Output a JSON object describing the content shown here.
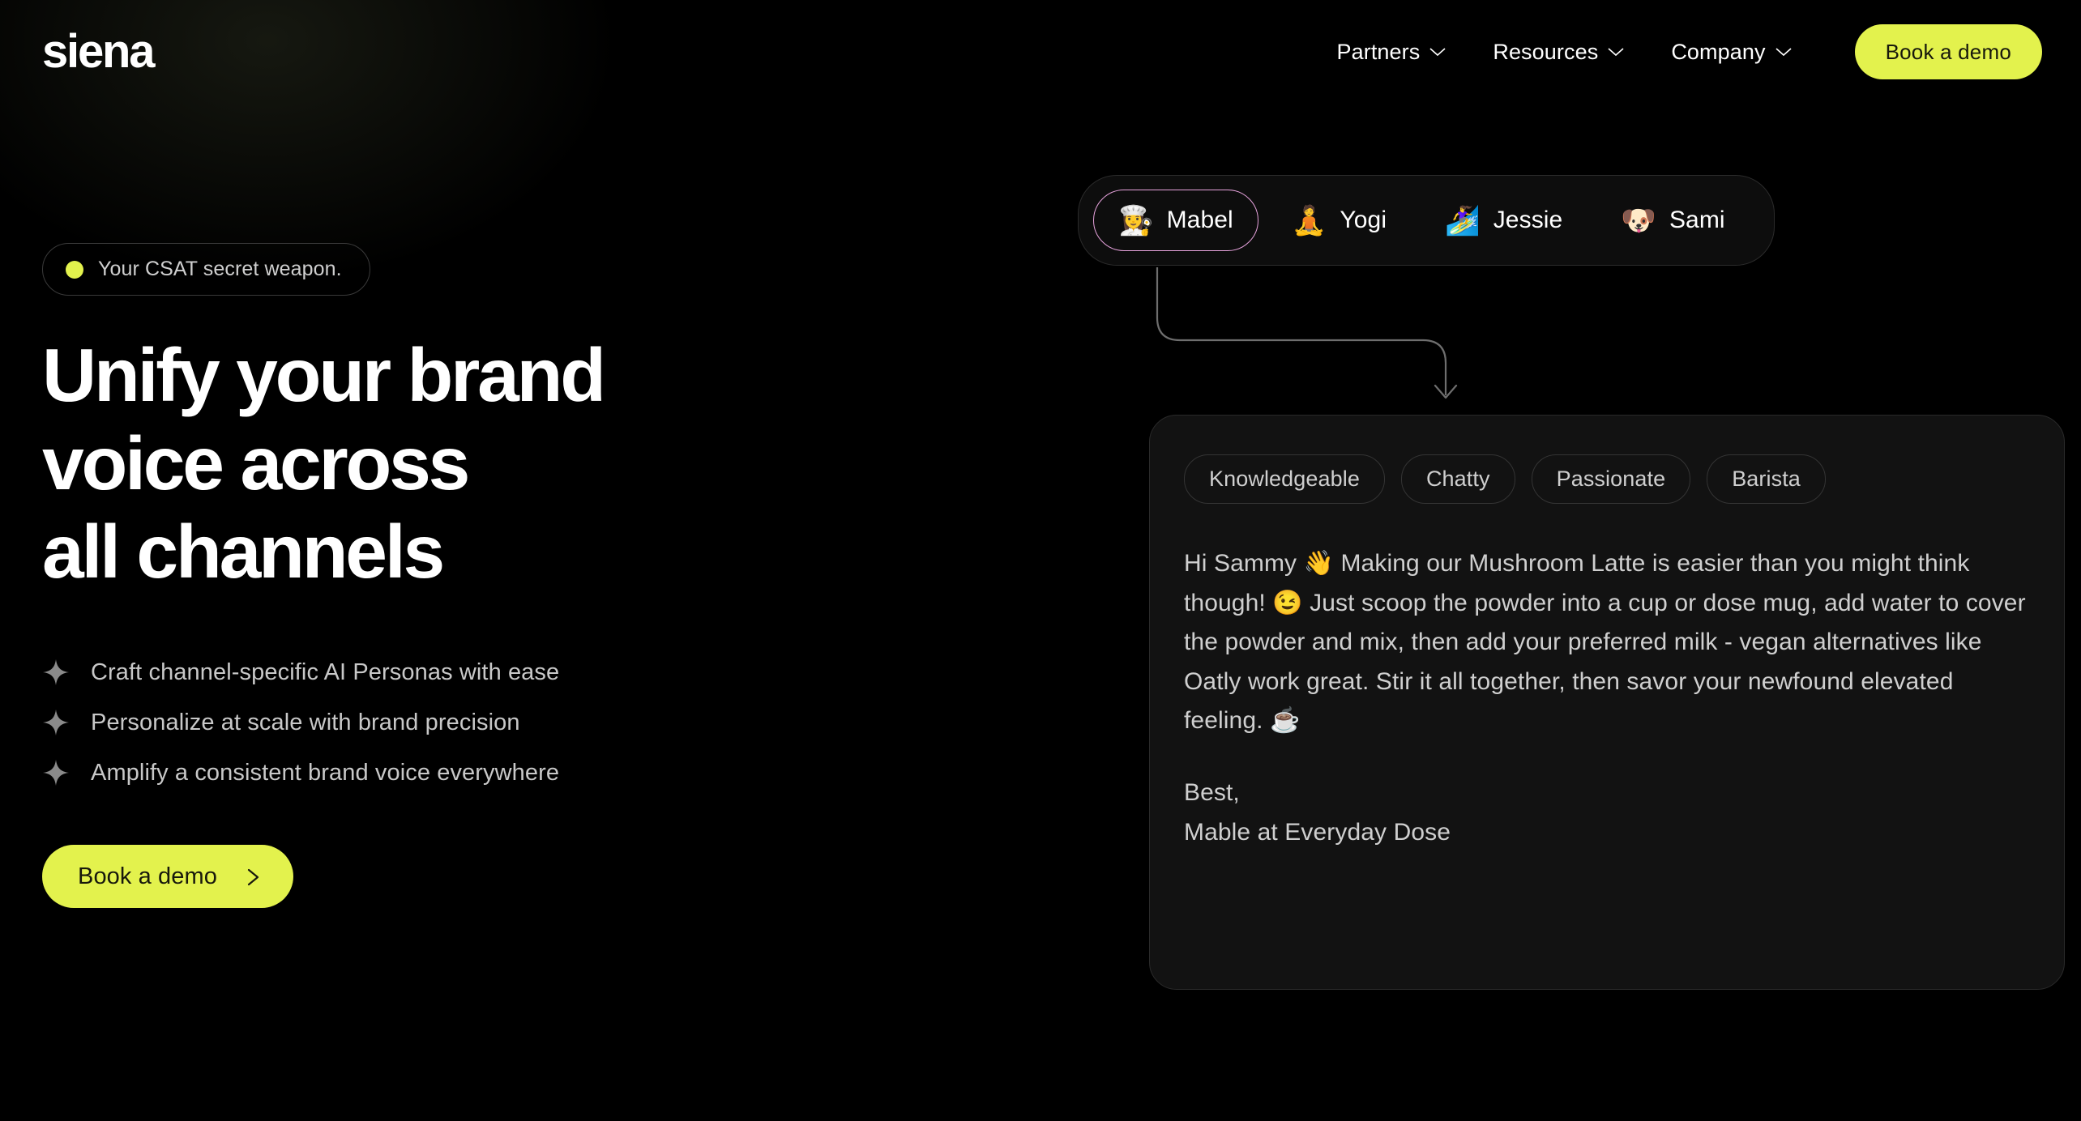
{
  "theme": {
    "background": "#000000",
    "accent": "#e3f24d",
    "accent_text": "#17180c",
    "card_bg": "#121212",
    "card_border": "#2a2a2a",
    "active_persona_border": "#e7a3dd",
    "body_text": "#cfcfcf"
  },
  "header": {
    "logo": "siena",
    "nav": [
      {
        "label": "Partners",
        "icon": "chevron-down-icon"
      },
      {
        "label": "Resources",
        "icon": "chevron-down-icon"
      },
      {
        "label": "Company",
        "icon": "chevron-down-icon"
      }
    ],
    "cta_label": "Book a demo"
  },
  "hero": {
    "badge": {
      "dot_color": "#e3f24d",
      "text": "Your CSAT secret weapon."
    },
    "headline_lines": [
      "Unify your brand",
      "voice across",
      "all channels"
    ],
    "bullets": [
      {
        "icon": "sparkle-icon",
        "text": "Craft channel-specific AI Personas with ease"
      },
      {
        "icon": "sparkle-icon",
        "text": "Personalize at scale with brand precision"
      },
      {
        "icon": "sparkle-icon",
        "text": "Amplify a consistent brand voice everywhere"
      }
    ],
    "cta": {
      "label": "Book a demo",
      "icon": "chevron-right-icon"
    }
  },
  "demo": {
    "personas": [
      {
        "emoji": "👩‍🍳",
        "name": "Mabel",
        "active": true
      },
      {
        "emoji": "🧘",
        "name": "Yogi",
        "active": false
      },
      {
        "emoji": "🏄‍♀️",
        "name": "Jessie",
        "active": false
      },
      {
        "emoji": "🐶",
        "name": "Sami",
        "active": false
      }
    ],
    "tags": [
      "Knowledgeable",
      "Chatty",
      "Passionate",
      "Barista"
    ],
    "message": "Hi Sammy 👋 Making our Mushroom Latte is easier than you might think though! 😉 Just scoop the powder into a cup or dose mug, add water to cover the powder and mix, then add your preferred milk - vegan alternatives like Oatly work great. Stir it all together, then savor your newfound elevated feeling. ☕",
    "signature": "Best,\nMable at Everyday Dose"
  }
}
